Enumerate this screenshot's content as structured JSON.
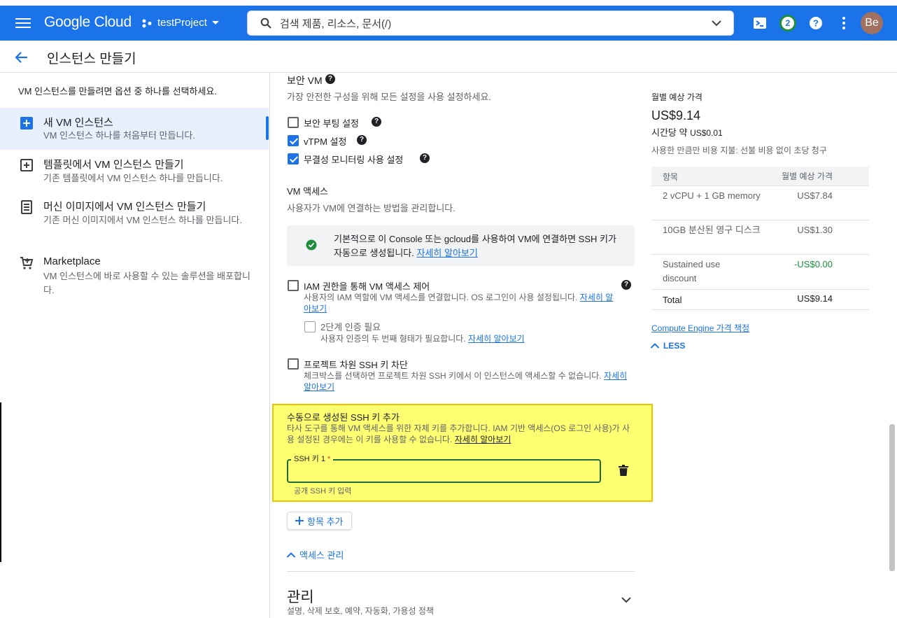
{
  "topbar": {
    "logo": "Google Cloud",
    "project": "testProject",
    "search_placeholder": "검색   제품, 리소스, 문서(/)",
    "notifications_count": "2",
    "avatar_initials": "Be"
  },
  "page": {
    "title": "인스턴스 만들기"
  },
  "left_panel": {
    "intro": "VM 인스턴스를 만들려면 옵션 중 하나를 선택하세요.",
    "options": [
      {
        "title": "새 VM 인스턴스",
        "desc": "VM 인스턴스 하나를 처음부터 만듭니다."
      },
      {
        "title": "템플릿에서 VM 인스턴스 만들기",
        "desc": "기존 템플릿에서 VM 인스턴스 하나를 만듭니다."
      },
      {
        "title": "머신 이미지에서 VM 인스턴스 만들기",
        "desc": "기존 머신 이미지에서 VM 인스턴스 하나를 만듭니다."
      },
      {
        "title": "Marketplace",
        "desc": "VM 인스턴스에 바로 사용할 수 있는 솔루션을 배포합니다."
      }
    ]
  },
  "secure_vm": {
    "title": "보안 VM",
    "desc": "가장 안전한 구성을 위해 모든 설정을 사용 설정하세요.",
    "options": [
      {
        "label": "보안 부팅 설정",
        "checked": false
      },
      {
        "label": "vTPM 설정",
        "checked": true
      },
      {
        "label": "무결성 모니터링 사용 설정",
        "checked": true
      }
    ]
  },
  "vm_access": {
    "title": "VM 액세스",
    "desc": "사용자가 VM에 연결하는 방법을 관리합니다.",
    "info_text": "기본적으로 이 Console 또는 gcloud를 사용하여 VM에 연결하면 SSH 키가 자동으로 생성됩니다.",
    "info_link": "자세히 알아보기",
    "iam": {
      "label": "IAM 권한을 통해 VM 액세스 제어",
      "desc": "사용자의 IAM 역할에 VM 액세스를 연결합니다. OS 로그인이 사용 설정됩니다.",
      "link": "자세히 알아보기"
    },
    "two_factor": {
      "label": "2단계 인증 필요",
      "desc": "사용자 인증의 두 번째 형태가 필요합니다.",
      "link": "자세히 알아보기"
    },
    "block_project_ssh": {
      "label": "프로젝트 차원 SSH 키 차단",
      "desc": "체크박스를 선택하면 프로젝트 차원 SSH 키에서 이 인스턴스에 액세스할 수 없습니다.",
      "link": "자세히 알아보기"
    },
    "manual_ssh": {
      "title": "수동으로 생성된 SSH 키 추가",
      "desc": "타사 도구를 통해 VM 액세스를 위한 자체 키를 추가합니다. IAM 기반 액세스(OS 로그인 사용)가 사용 설정된 경우에는 이 키를 사용할 수 없습니다.",
      "link": "자세히 알아보기",
      "field_label": "SSH 키 1",
      "field_required": "*",
      "field_hint": "공개 SSH 키 입력",
      "field_value": ""
    },
    "add_item": "항목 추가",
    "collapse_label": "액세스 관리"
  },
  "management": {
    "title": "관리",
    "desc": "설명, 삭제 보호, 예약, 자동화, 가용성 정책"
  },
  "pricing": {
    "label": "월별 예상 가격",
    "monthly": "US$9.14",
    "hourly_prefix": "시간당 약",
    "hourly": "US$0.01",
    "note": "사용한 만큼만 비용 지불: 선불 비용 없이 초당 청구",
    "table_headers": [
      "항목",
      "월별 예상 가격"
    ],
    "rows": [
      {
        "item": "2 vCPU + 1 GB memory",
        "price": "US$7.84"
      },
      {
        "item": "10GB 분산된 영구 디스크",
        "price": "US$1.30"
      },
      {
        "item": "Sustained use discount",
        "price": "-US$0.00"
      },
      {
        "item": "Total",
        "price": "US$9.14"
      }
    ],
    "link": "Compute Engine 가격 책정",
    "less": "LESS",
    "colors": {
      "discount": "#1e8e3e",
      "link": "#1a73e8"
    }
  }
}
